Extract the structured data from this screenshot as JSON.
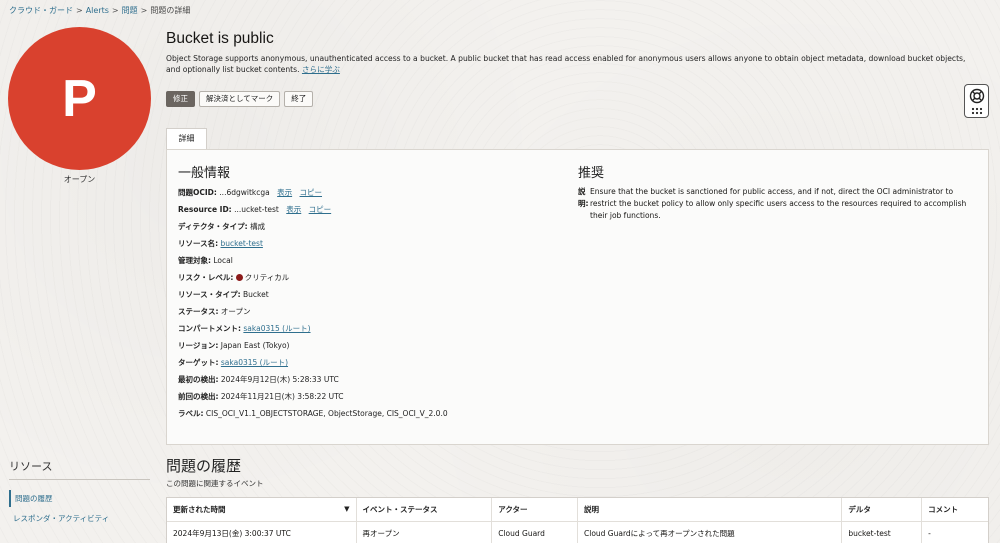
{
  "breadcrumb": {
    "items": [
      "クラウド・ガード",
      "Alerts",
      "問題",
      "問題の詳細"
    ],
    "separator": ">"
  },
  "avatar": {
    "letter": "P",
    "status": "オープン",
    "color": "#d9412e"
  },
  "header": {
    "title": "Bucket is public",
    "description": "Object Storage supports anonymous, unauthenticated access to a bucket. A public bucket that has read access enabled for anonymous users allows anyone to obtain object metadata, download bucket objects, and optionally list bucket contents.",
    "learn_more": "さらに学ぶ"
  },
  "actions": {
    "remediate": "修正",
    "mark_resolved": "解決済としてマーク",
    "dismiss": "終了"
  },
  "tabs": {
    "details": "詳細"
  },
  "general": {
    "title": "一般情報",
    "problem_ocid_label": "問題OCID:",
    "problem_ocid_value": "...6dgwitkcga",
    "resource_id_label": "Resource ID:",
    "resource_id_value": "...ucket-test",
    "show": "表示",
    "copy": "コピー",
    "detector_type_label": "ディテクタ・タイプ:",
    "detector_type_value": "構成",
    "resource_name_label": "リソース名:",
    "resource_name_value": "bucket-test",
    "managed_label": "管理対象:",
    "managed_value": "Local",
    "risk_level_label": "リスク・レベル:",
    "risk_level_value": "クリティカル",
    "resource_type_label": "リソース・タイプ:",
    "resource_type_value": "Bucket",
    "status_label": "ステータス:",
    "status_value": "オープン",
    "compartment_label": "コンパートメント:",
    "compartment_value": "saka0315 (ルート)",
    "region_label": "リージョン:",
    "region_value": "Japan East (Tokyo)",
    "target_label": "ターゲット:",
    "target_value": "saka0315 (ルート)",
    "first_detected_label": "最初の検出:",
    "first_detected_value": "2024年9月12日(木) 5:28:33 UTC",
    "last_detected_label": "前回の検出:",
    "last_detected_value": "2024年11月21日(木) 3:58:22 UTC",
    "labels_label": "ラベル:",
    "labels_value": "CIS_OCI_V1.1_OBJECTSTORAGE, ObjectStorage, CIS_OCI_V_2.0.0"
  },
  "recommendation": {
    "title": "推奨",
    "label": "説明:",
    "text": "Ensure that the bucket is sanctioned for public access, and if not, direct the OCI administrator to restrict the bucket policy to allow only specific users access to the resources required to accomplish their job functions."
  },
  "resources": {
    "title": "リソース",
    "items": [
      "問題の履歴",
      "レスポンダ・アクティビティ"
    ]
  },
  "history": {
    "title": "問題の履歴",
    "subtitle": "この問題に関連するイベント",
    "columns": [
      "更新された時間",
      "イベント・ステータス",
      "アクター",
      "説明",
      "デルタ",
      "コメント"
    ],
    "rows": [
      [
        "2024年9月13日(金) 3:00:37 UTC",
        "再オープン",
        "Cloud Guard",
        "Cloud Guardによって再オープンされた問題",
        "bucket-test",
        "-"
      ]
    ]
  }
}
